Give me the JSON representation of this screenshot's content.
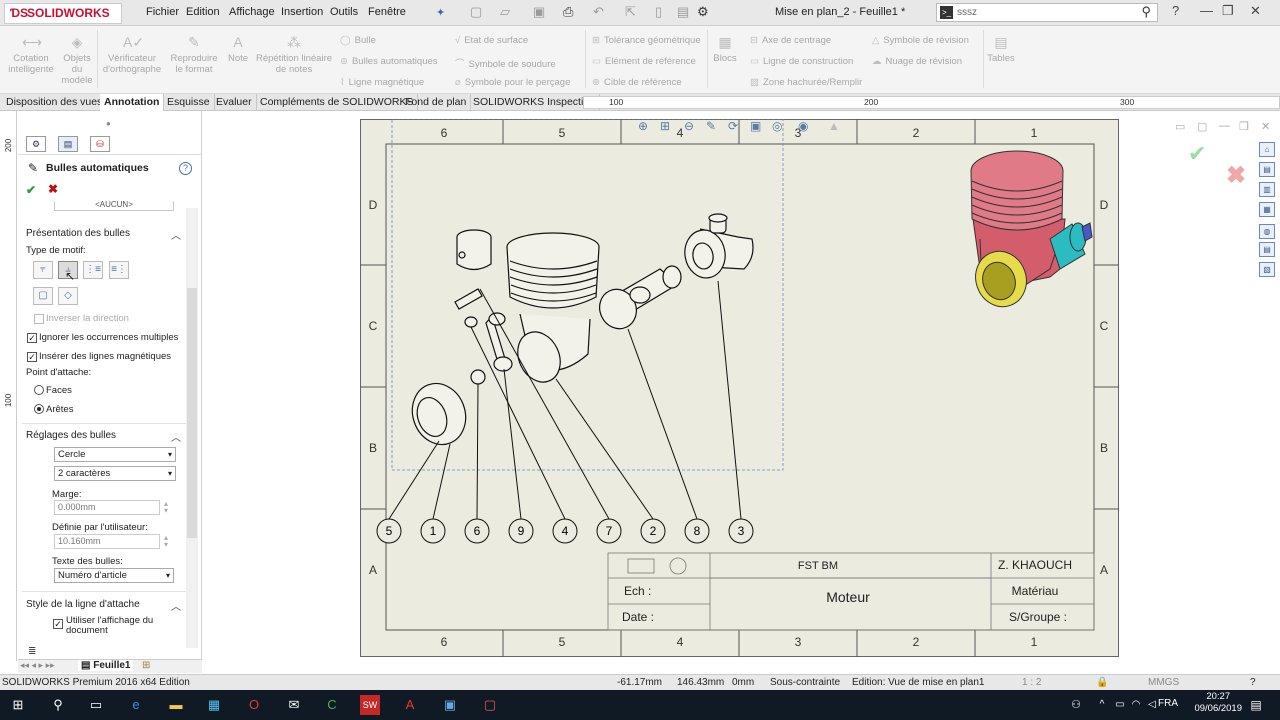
{
  "app": {
    "brand": "SOLIDWORKS",
    "doc_title": "Mise en plan_2 - Feuille1 *",
    "search_value": "sssz",
    "menu": [
      "Fichier",
      "Edition",
      "Affichage",
      "Insertion",
      "Outils",
      "Fenêtre"
    ]
  },
  "ribbon": {
    "big": [
      {
        "label": "Cotation intelligente",
        "icon": "smart-dimension-icon"
      },
      {
        "label": "Objets du modèle",
        "icon": "model-items-icon"
      },
      {
        "label": "Vérificateur d'orthographe",
        "icon": "spell-check-icon"
      },
      {
        "label": "Reproduire le format",
        "icon": "format-painter-icon"
      },
      {
        "label": "Note",
        "icon": "note-icon"
      },
      {
        "label": "Répétition linéaire de notes",
        "icon": "linear-note-pattern-icon"
      },
      {
        "label": "Blocs",
        "icon": "blocks-icon"
      },
      {
        "label": "Tables",
        "icon": "tables-icon"
      }
    ],
    "small": {
      "bulle": "Bulle",
      "bulles_auto": "Bulles automatiques",
      "ligne_magnetique": "Ligne magnétique",
      "etat_surface": "Etat de surface",
      "symbole_soudure": "Symbole de soudure",
      "symbole_percage": "Symbole pour le perçage",
      "tolerance_geo": "Tolérance géométrique",
      "element_ref": "Elément de référence",
      "cible_ref": "Cible de référence",
      "axe_centrage": "Axe de centrage",
      "ligne_construction": "Ligne de construction",
      "zone_hachuree": "Zone hachurée/Remplir",
      "symbole_revision": "Symbole de révision",
      "nuage_revision": "Nuage de révision"
    }
  },
  "tabs": [
    "Disposition des vues",
    "Annotation",
    "Esquisse",
    "Evaluer",
    "Compléments de SOLIDWORKS",
    "Fond de plan",
    "SOLIDWORKS Inspection"
  ],
  "active_tab": "Annotation",
  "ruler": {
    "h": [
      "100",
      "200",
      "300"
    ],
    "v": [
      "200",
      "100"
    ]
  },
  "panel": {
    "title": "Bulles automatiques",
    "help": "?",
    "truncated_combo": "<AUCUN>",
    "presentation": {
      "header": "Présentation des bulles",
      "type_motif": "Type de motif:",
      "inverser": "Inverser la direction",
      "ignorer": "Ignorer les occurrences multiples",
      "inserer_lignes": "Insérer des lignes magnétiques",
      "point_attache": "Point d'attache:",
      "faces": "Faces",
      "aretes": "Arêtes"
    },
    "reglages": {
      "header": "Réglages des bulles",
      "style": "Cercle",
      "taille": "2 caractères",
      "marge_label": "Marge:",
      "marge_value": "0.000mm",
      "user_label": "Définie par l'utilisateur:",
      "user_value": "10.160mm",
      "texte_label": "Texte des bulles:",
      "texte_value": "Numéro d'article"
    },
    "ligne_attache": {
      "header": "Style de la ligne d'attache",
      "utiliser": "Utiliser l'affichage du document"
    },
    "sheet_tab": "Feuille1"
  },
  "drawing": {
    "zones_top": [
      "6",
      "5",
      "4",
      "3",
      "2",
      "1"
    ],
    "zones_side": [
      "D",
      "C",
      "B",
      "A"
    ],
    "balloons": [
      "5",
      "1",
      "6",
      "9",
      "4",
      "7",
      "2",
      "8",
      "3"
    ],
    "title_block": {
      "org": "FST BM",
      "author": "Z. KHAOUCH",
      "ech": "Ech :",
      "title": "Moteur",
      "materiau": "Matériau",
      "date": "Date :",
      "groupe": "S/Groupe :"
    }
  },
  "status": {
    "edition": "SOLIDWORKS Premium 2016 x64 Edition",
    "x": "-61.17mm",
    "y": "146.43mm",
    "z": "0mm",
    "state": "Sous-contrainte",
    "mode": "Edition: Vue de mise en plan1",
    "scale": "1 : 2",
    "units": "MMGS"
  },
  "taskbar": {
    "lang": "FRA",
    "time": "20:27",
    "date": "09/06/2019"
  }
}
